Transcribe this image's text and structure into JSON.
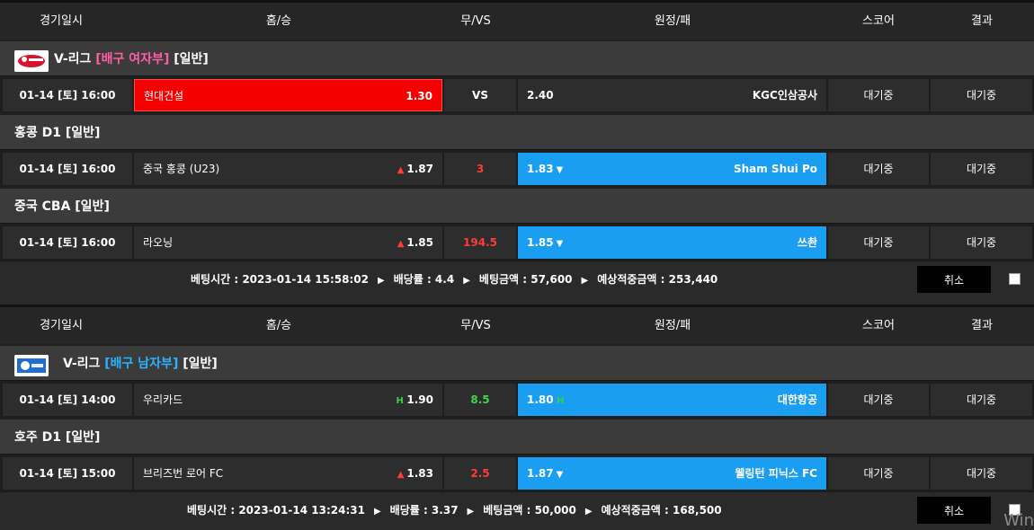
{
  "columns": {
    "datetime": "경기일시",
    "home": "홈/승",
    "draw": "무/VS",
    "away": "원정/패",
    "score": "스코어",
    "result": "결과"
  },
  "colors": {
    "hot": "#f50000",
    "blue": "#1a9ef2",
    "pink": "#ff5fa2",
    "cyan": "#2ab4ff",
    "red": "#ff3b3b",
    "green": "#44d44b"
  },
  "slip1": {
    "groups": [
      {
        "league_prefix": "V-리그 ",
        "league_tag": "[배구 여자부]",
        "league_suffix": " [일반]",
        "logo": "v-league-women-logo",
        "match": {
          "datetime": "01-14 [토] 16:00",
          "home_team": "현대건설",
          "home_odd": "1.30",
          "draw": "VS",
          "away_odd": "2.40",
          "away_team": "KGC인삼공사",
          "score": "대기중",
          "result": "대기중"
        }
      },
      {
        "league_prefix": "홍콩 D1 [일반]",
        "match": {
          "datetime": "01-14 [토] 16:00",
          "home_team": "중국 홍콩 (U23)",
          "home_odd": "1.87",
          "draw": "3",
          "away_odd": "1.83",
          "away_team": "Sham Shui Po",
          "score": "대기중",
          "result": "대기중"
        }
      },
      {
        "league_prefix": "중국 CBA [일반]",
        "match": {
          "datetime": "01-14 [토] 16:00",
          "home_team": "라오닝",
          "home_odd": "1.85",
          "draw": "194.5",
          "away_odd": "1.85",
          "away_team": "쓰촨",
          "score": "대기중",
          "result": "대기중"
        }
      }
    ],
    "summary": {
      "bet_time": "베팅시간 : 2023-01-14 15:58:02",
      "odds": "배당률 : 4.4",
      "amount": "베팅금액 : 57,600",
      "expected": "예상적중금액 : 253,440",
      "cancel": "취소"
    }
  },
  "slip2": {
    "groups": [
      {
        "league_prefix": "V-리그 ",
        "league_tag": "[배구 남자부]",
        "league_suffix": " [일반]",
        "logo": "v-league-men-logo",
        "match": {
          "datetime": "01-14 [토] 14:00",
          "home_team": "우리카드",
          "home_odd": "1.90",
          "draw": "8.5",
          "away_odd": "1.80",
          "away_team": "대한항공",
          "score": "대기중",
          "result": "대기중"
        }
      },
      {
        "league_prefix": "호주 D1 [일반]",
        "match": {
          "datetime": "01-14 [토] 15:00",
          "home_team": "브리즈번 로어 FC",
          "home_odd": "1.83",
          "draw": "2.5",
          "away_odd": "1.87",
          "away_team": "웰링턴 피닉스 FC",
          "score": "대기중",
          "result": "대기중"
        }
      }
    ],
    "summary": {
      "bet_time": "베팅시간 : 2023-01-14 13:24:31",
      "odds": "배당률 : 3.37",
      "amount": "베팅금액 : 50,000",
      "expected": "예상적중금액 : 168,500",
      "cancel": "취소"
    }
  },
  "overlay": {
    "watermark": "Win"
  }
}
